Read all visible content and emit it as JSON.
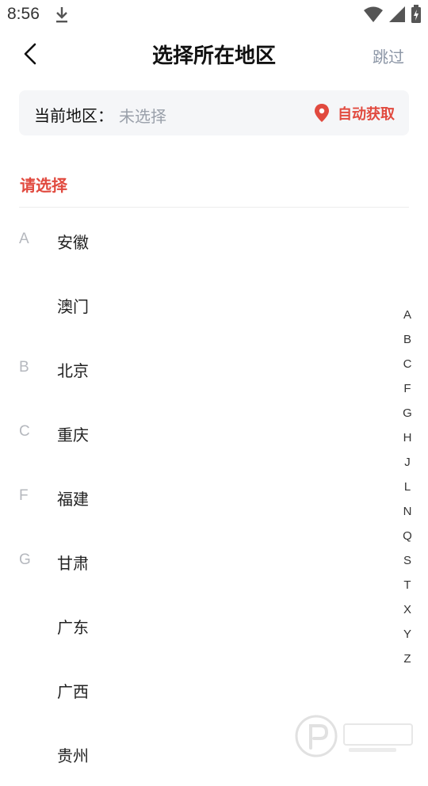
{
  "status_bar": {
    "time": "8:56"
  },
  "header": {
    "title": "选择所在地区",
    "skip_label": "跳过"
  },
  "current_region": {
    "label": "当前地区：",
    "value": "未选择",
    "auto_get_label": "自动获取"
  },
  "section_title": "请选择",
  "regions": [
    {
      "letter": "A",
      "name": "安徽"
    },
    {
      "letter": "",
      "name": "澳门"
    },
    {
      "letter": "B",
      "name": "北京"
    },
    {
      "letter": "C",
      "name": "重庆"
    },
    {
      "letter": "F",
      "name": "福建"
    },
    {
      "letter": "G",
      "name": "甘肃"
    },
    {
      "letter": "",
      "name": "广东"
    },
    {
      "letter": "",
      "name": "广西"
    },
    {
      "letter": "",
      "name": "贵州"
    }
  ],
  "alphabet": [
    "A",
    "B",
    "C",
    "F",
    "G",
    "H",
    "J",
    "L",
    "N",
    "Q",
    "S",
    "T",
    "X",
    "Y",
    "Z"
  ],
  "colors": {
    "accent": "#e14a3f",
    "muted": "#9aa0aa",
    "card_bg": "#f5f6f8"
  }
}
